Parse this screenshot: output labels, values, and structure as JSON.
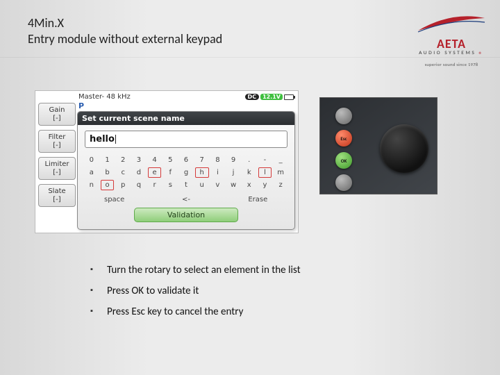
{
  "header": {
    "title_line1": "4Min.X",
    "title_line2": "Entry module without external keypad"
  },
  "logo": {
    "brand_top": "AETA",
    "brand_sub": "AUDIO SYSTEMS",
    "tagline": "superior sound since 1978",
    "registered": "®"
  },
  "device": {
    "status": {
      "master": "Master- 48 kHz",
      "dc": "DC",
      "voltage": "12.1V"
    },
    "side_buttons": [
      {
        "line1": "Gain",
        "line2": "[-]"
      },
      {
        "line1": "Filter",
        "line2": "[-]"
      },
      {
        "line1": "Limiter",
        "line2": "[-]"
      },
      {
        "line1": "Slate",
        "line2": "[-]"
      }
    ],
    "panel_prefix": "P",
    "dialog": {
      "title": "Set current scene name",
      "input_value": "hello",
      "grid": [
        [
          "0",
          "1",
          "2",
          "3",
          "4",
          "5",
          "6",
          "7",
          "8",
          "9",
          ".",
          "-",
          "_"
        ],
        [
          "a",
          "b",
          "c",
          "d",
          "e",
          "f",
          "g",
          "h",
          "i",
          "j",
          "k",
          "l",
          "m"
        ],
        [
          "n",
          "o",
          "p",
          "q",
          "r",
          "s",
          "t",
          "u",
          "v",
          "w",
          "x",
          "y",
          "z"
        ]
      ],
      "used_cells": [
        "e",
        "h",
        "l",
        "o"
      ],
      "actions": {
        "space": "space",
        "back": "<-",
        "erase": "Erase"
      },
      "validate": "Validation"
    }
  },
  "hardware": {
    "esc_label": "Esc",
    "ok_label": "OK"
  },
  "bullets": [
    "Turn the rotary to select an element in the list",
    "Press OK to validate it",
    "Press Esc key to cancel the entry"
  ]
}
